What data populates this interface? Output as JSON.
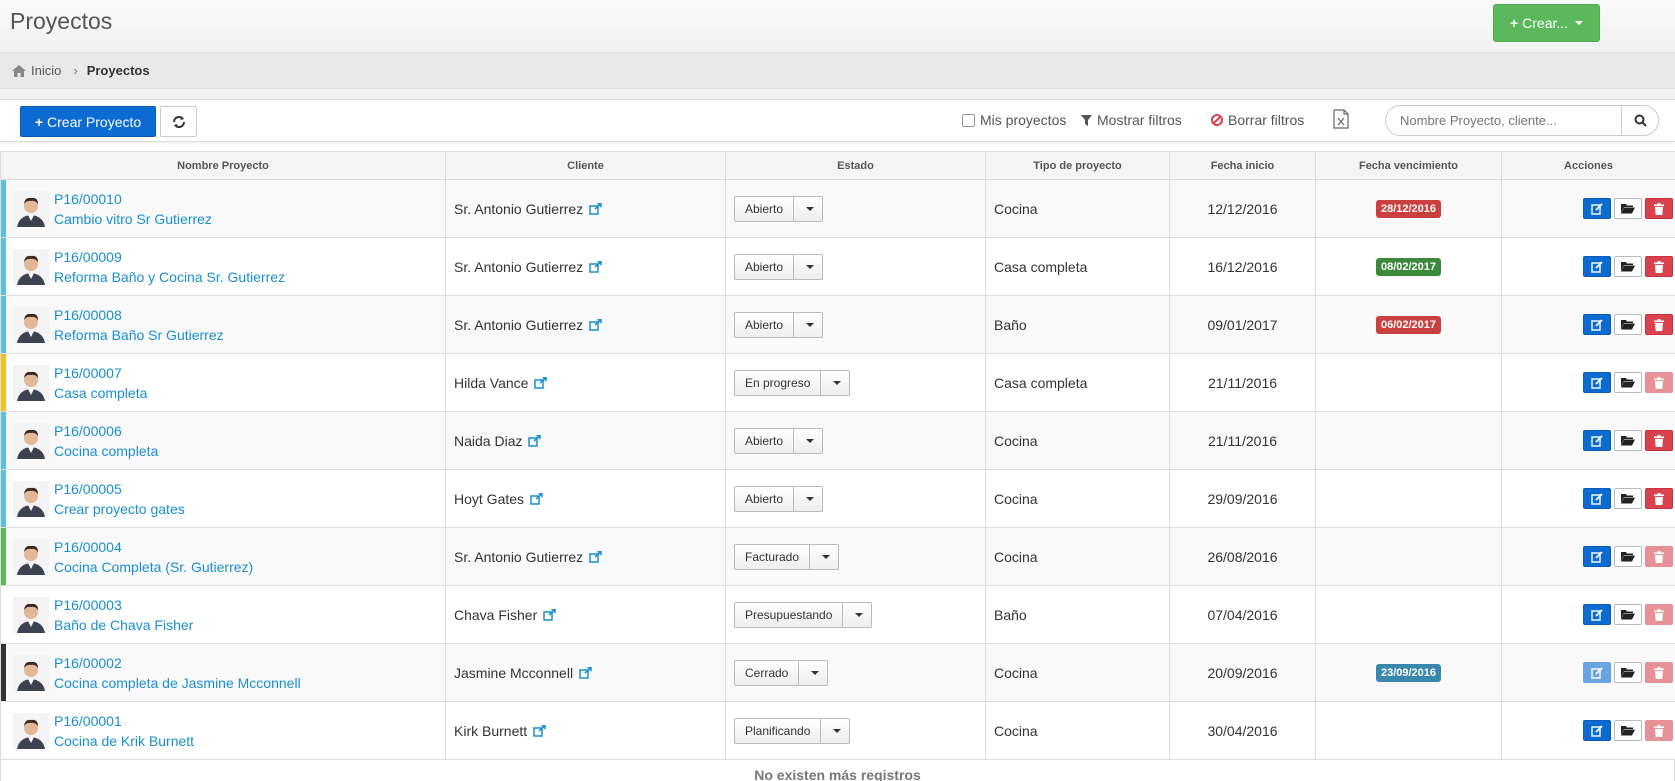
{
  "header": {
    "title": "Proyectos",
    "create_label": "Crear..."
  },
  "breadcrumb": {
    "home_label": "Inicio",
    "current": "Proyectos"
  },
  "toolbar": {
    "create_project_label": "Crear Proyecto",
    "my_projects_label": "Mis proyectos",
    "show_filters_label": "Mostrar filtros",
    "clear_filters_label": "Borrar filtros",
    "search_placeholder": "Nombre Proyecto, cliente..."
  },
  "table": {
    "columns": [
      "Nombre Proyecto",
      "Cliente",
      "Estado",
      "Tipo de proyecto",
      "Fecha inicio",
      "Fecha vencimiento",
      "Acciones"
    ],
    "rows": [
      {
        "code": "P16/00010",
        "name": "Cambio vitro Sr Gutierrez",
        "client": "Sr. Antonio Gutierrez",
        "status": "Abierto",
        "type": "Cocina",
        "start": "12/12/2016",
        "due": "28/12/2016",
        "due_color": "#c9403f",
        "bar_color": "#5bc0de",
        "edit_faded": false,
        "delete_faded": false
      },
      {
        "code": "P16/00009",
        "name": "Reforma Baño y Cocina Sr. Gutierrez",
        "client": "Sr. Antonio Gutierrez",
        "status": "Abierto",
        "type": "Casa completa",
        "start": "16/12/2016",
        "due": "08/02/2017",
        "due_color": "#3b8a3b",
        "bar_color": "#5bc0de",
        "edit_faded": false,
        "delete_faded": false
      },
      {
        "code": "P16/00008",
        "name": "Reforma Baño Sr Gutierrez",
        "client": "Sr. Antonio Gutierrez",
        "status": "Abierto",
        "type": "Baño",
        "start": "09/01/2017",
        "due": "06/02/2017",
        "due_color": "#c9403f",
        "bar_color": "#5bc0de",
        "edit_faded": false,
        "delete_faded": false
      },
      {
        "code": "P16/00007",
        "name": "Casa completa",
        "client": "Hilda Vance",
        "status": "En progreso",
        "type": "Casa completa",
        "start": "21/11/2016",
        "due": "",
        "due_color": "",
        "bar_color": "#f0c020",
        "edit_faded": false,
        "delete_faded": true
      },
      {
        "code": "P16/00006",
        "name": "Cocina completa",
        "client": "Naida Diaz",
        "status": "Abierto",
        "type": "Cocina",
        "start": "21/11/2016",
        "due": "",
        "due_color": "",
        "bar_color": "#5bc0de",
        "edit_faded": false,
        "delete_faded": false
      },
      {
        "code": "P16/00005",
        "name": "Crear proyecto gates",
        "client": "Hoyt Gates",
        "status": "Abierto",
        "type": "Cocina",
        "start": "29/09/2016",
        "due": "",
        "due_color": "",
        "bar_color": "#5bc0de",
        "edit_faded": false,
        "delete_faded": false
      },
      {
        "code": "P16/00004",
        "name": "Cocina Completa (Sr. Gutierrez)",
        "client": "Sr. Antonio Gutierrez",
        "status": "Facturado",
        "type": "Cocina",
        "start": "26/08/2016",
        "due": "",
        "due_color": "",
        "bar_color": "#5cb85c",
        "edit_faded": false,
        "delete_faded": true
      },
      {
        "code": "P16/00003",
        "name": "Baño de Chava Fisher",
        "client": "Chava Fisher",
        "status": "Presupuestando",
        "type": "Baño",
        "start": "07/04/2016",
        "due": "",
        "due_color": "",
        "bar_color": "",
        "edit_faded": false,
        "delete_faded": true
      },
      {
        "code": "P16/00002",
        "name": "Cocina completa de Jasmine Mcconnell",
        "client": "Jasmine Mcconnell",
        "status": "Cerrado",
        "type": "Cocina",
        "start": "20/09/2016",
        "due": "23/09/2016",
        "due_color": "#3a87ad",
        "bar_color": "#333333",
        "edit_faded": true,
        "delete_faded": true
      },
      {
        "code": "P16/00001",
        "name": "Cocina de Krik Burnett",
        "client": "Kirk Burnett",
        "status": "Planificando",
        "type": "Cocina",
        "start": "30/04/2016",
        "due": "",
        "due_color": "",
        "bar_color": "",
        "edit_faded": false,
        "delete_faded": true
      }
    ],
    "footer": "No existen más registros"
  }
}
